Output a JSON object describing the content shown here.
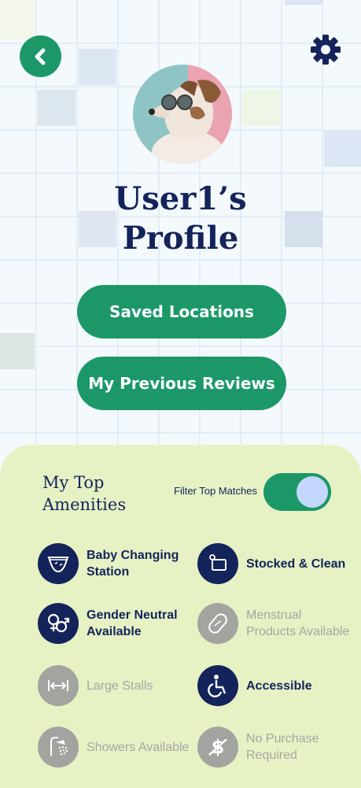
{
  "profile": {
    "title_line1": "User1’s",
    "title_line2": "Profile"
  },
  "buttons": {
    "saved_locations": "Saved Locations",
    "previous_reviews": "My Previous Reviews"
  },
  "amenities_panel": {
    "title": "My Top Amenities",
    "filter_label": "Filter Top Matches",
    "filter_on": true,
    "items": [
      {
        "label": "Baby Changing Station",
        "icon": "diaper-icon",
        "active": true
      },
      {
        "label": "Stocked & Clean",
        "icon": "paper-towel-icon",
        "active": true
      },
      {
        "label": "Gender Neutral Available",
        "icon": "gender-symbol-icon",
        "active": true
      },
      {
        "label": "Menstrual Products Available",
        "icon": "pad-icon",
        "active": false
      },
      {
        "label": "Large Stalls",
        "icon": "width-arrows-icon",
        "active": false
      },
      {
        "label": "Accessible",
        "icon": "wheelchair-icon",
        "active": true
      },
      {
        "label": "Showers Available",
        "icon": "shower-icon",
        "active": false
      },
      {
        "label": "No Purchase Required",
        "icon": "no-dollar-icon",
        "active": false
      }
    ]
  },
  "colors": {
    "primary_green": "#1c9868",
    "navy": "#14235a",
    "panel_bg": "#e6f2c4",
    "inactive_gray": "#a3a4a0",
    "toggle_knob": "#c4d8ff"
  }
}
